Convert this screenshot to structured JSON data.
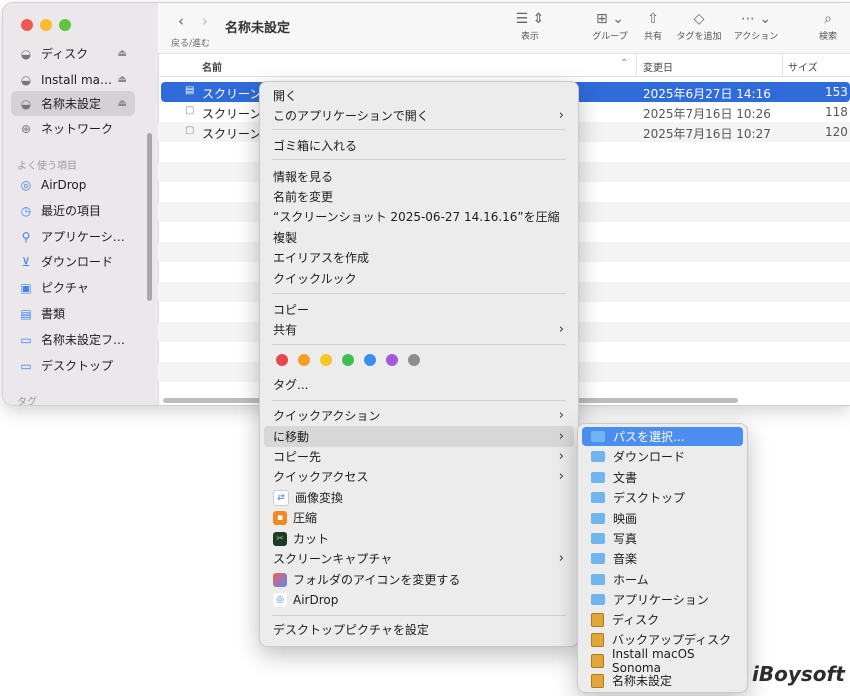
{
  "window": {
    "title": "名称未設定",
    "nav_label": "戻る/進む"
  },
  "toolbar": {
    "view": "表示",
    "group": "グループ",
    "share": "共有",
    "add_tag": "タグを追加",
    "action": "アクション",
    "search": "検索"
  },
  "sidebar": {
    "items_top": [
      {
        "label": "ディスク",
        "icon": "disk-icon"
      },
      {
        "label": "Install mac…",
        "icon": "disk-icon"
      },
      {
        "label": "名称未設定",
        "icon": "disk-icon"
      },
      {
        "label": "ネットワーク",
        "icon": "globe-icon"
      }
    ],
    "favorites_title": "よく使う項目",
    "favorites": [
      {
        "label": "AirDrop",
        "icon": "airdrop-icon"
      },
      {
        "label": "最近の項目",
        "icon": "clock-icon"
      },
      {
        "label": "アプリケーシ…",
        "icon": "apps-icon"
      },
      {
        "label": "ダウンロード",
        "icon": "download-icon"
      },
      {
        "label": "ピクチャ",
        "icon": "picture-icon"
      },
      {
        "label": "書類",
        "icon": "document-icon"
      },
      {
        "label": "名称未設定フ…",
        "icon": "folder-icon"
      },
      {
        "label": "デスクトップ",
        "icon": "desktop-icon"
      }
    ],
    "tags_title": "タグ"
  },
  "list": {
    "columns": {
      "name": "名前",
      "modified": "変更日",
      "size": "サイズ"
    },
    "rows": [
      {
        "name": "スクリーン",
        "date": "2025年6月27日 14:16",
        "size": "153"
      },
      {
        "name": "スクリーン",
        "date": "2025年7月16日 10:26",
        "size": "118"
      },
      {
        "name": "スクリーン",
        "date": "2025年7月16日 10:27",
        "size": "120"
      }
    ]
  },
  "context_menu": {
    "open": "開く",
    "open_with": "このアプリケーションで開く",
    "trash": "ゴミ箱に入れる",
    "get_info": "情報を見る",
    "rename": "名前を変更",
    "compress": "“スクリーンショット 2025-06-27 14.16.16”を圧縮",
    "duplicate": "複製",
    "make_alias": "エイリアスを作成",
    "quick_look": "クイックルック",
    "copy": "コピー",
    "share": "共有",
    "tags": "タグ...",
    "quick_actions": "クイックアクション",
    "move_to": "に移動",
    "copy_to": "コピー先",
    "quick_access": "クイックアクセス",
    "image_convert": "画像変換",
    "compress2": "圧縮",
    "cut": "カット",
    "screen_capture": "スクリーンキャプチャ",
    "change_folder_icon": "フォルダのアイコンを変更する",
    "airdrop": "AirDrop",
    "set_desktop_picture": "デスクトップピクチャを設定",
    "tag_colors": [
      "#e5484d",
      "#f59e2a",
      "#f5c626",
      "#3fbf4f",
      "#3a8ef0",
      "#a55bd6",
      "#8e8e8e"
    ]
  },
  "submenu": {
    "items": [
      "パスを選択...",
      "ダウンロード",
      "文書",
      "デスクトップ",
      "映画",
      "写真",
      "音楽",
      "ホーム",
      "アプリケーション",
      "ディスク",
      "バックアップディスク",
      "Install macOS Sonoma",
      "名称未設定"
    ]
  },
  "watermark": "iBoysoft"
}
